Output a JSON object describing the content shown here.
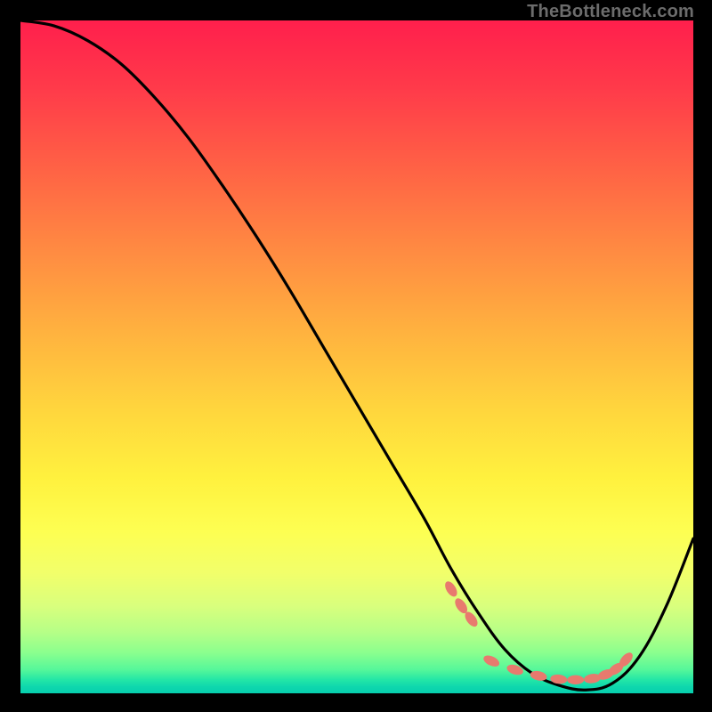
{
  "watermark": {
    "text": "TheBottleneck.com"
  },
  "chart_data": {
    "type": "line",
    "title": "",
    "xlabel": "",
    "ylabel": "",
    "xlim": [
      0,
      100
    ],
    "ylim": [
      0,
      100
    ],
    "grid": false,
    "legend": false,
    "description": "V-shaped bottleneck curve over vertical red→green quality gradient",
    "series": [
      {
        "name": "bottleneck-curve",
        "color": "#000000",
        "x": [
          0,
          5,
          10,
          15,
          20,
          25,
          30,
          35,
          40,
          45,
          50,
          55,
          60,
          64,
          68,
          72,
          76,
          80,
          84,
          88,
          92,
          96,
          100
        ],
        "values": [
          100,
          99.2,
          97.0,
          93.5,
          88.5,
          82.5,
          75.5,
          68.0,
          60.0,
          51.5,
          43.0,
          34.5,
          26.0,
          18.5,
          12.0,
          6.5,
          3.0,
          1.2,
          0.5,
          1.5,
          5.5,
          13.0,
          23.0
        ]
      }
    ],
    "markers": {
      "name": "optimum-band",
      "color": "#e87a6e",
      "x": [
        64.0,
        65.5,
        67.0,
        70.0,
        73.5,
        77.0,
        80.0,
        82.5,
        85.0,
        87.0,
        88.5,
        90.0
      ],
      "values": [
        15.5,
        13.0,
        11.0,
        4.8,
        3.5,
        2.6,
        2.1,
        2.0,
        2.2,
        2.8,
        3.6,
        5.0
      ],
      "angles_deg": [
        58,
        56,
        54,
        25,
        18,
        12,
        6,
        0,
        -8,
        -20,
        -35,
        -48
      ]
    },
    "gradient_stops": [
      {
        "pct": 0,
        "color": "#ff1f4c"
      },
      {
        "pct": 22,
        "color": "#ff6245"
      },
      {
        "pct": 46,
        "color": "#ffb13f"
      },
      {
        "pct": 68,
        "color": "#fff13e"
      },
      {
        "pct": 87,
        "color": "#d9ff7d"
      },
      {
        "pct": 96.5,
        "color": "#55f79a"
      },
      {
        "pct": 100,
        "color": "#06cfae"
      }
    ]
  }
}
